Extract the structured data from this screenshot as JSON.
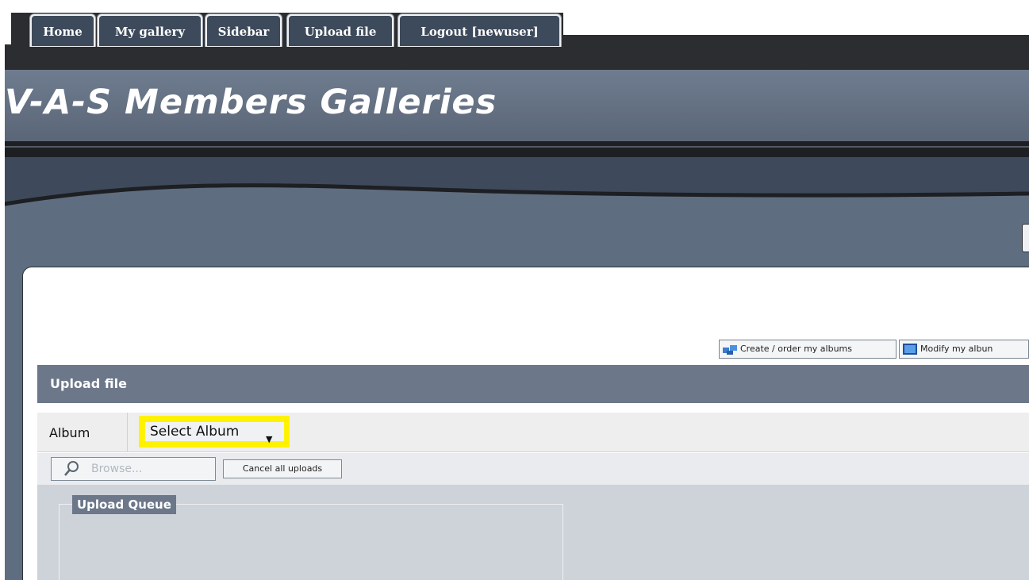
{
  "nav": {
    "items": [
      {
        "label": "Home"
      },
      {
        "label": "My gallery"
      },
      {
        "label": "Sidebar"
      },
      {
        "label": "Upload file"
      },
      {
        "label": "Logout [newuser]"
      }
    ]
  },
  "header": {
    "site_title": "V-A-S Members Galleries"
  },
  "toolbar": {
    "create_albums_label": "Create / order my albums",
    "modify_albums_label": "Modify my albun"
  },
  "upload": {
    "title": "Upload file",
    "album_label": "Album",
    "album_select_value": "Select Album",
    "browse_label": "Browse...",
    "cancel_label": "Cancel all uploads",
    "queue_title": "Upload Queue"
  },
  "icons": {
    "search": "magnifier-icon",
    "create_albums": "albums-icon",
    "modify_albums": "modify-albums-icon",
    "dropdown": "chevron-down-icon"
  },
  "colors": {
    "highlight": "#fff200",
    "nav_bg": "#3d4a5b",
    "section_header": "#6c778a"
  }
}
